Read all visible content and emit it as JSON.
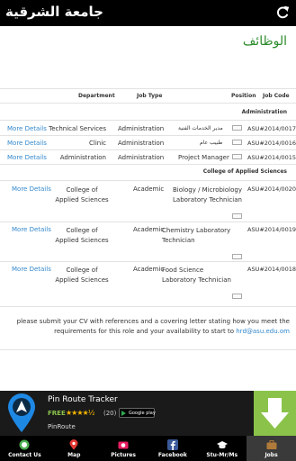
{
  "app": {
    "title": "جامعة الشرقية",
    "refresh_icon": "refresh-icon"
  },
  "page": {
    "heading": "الوظائف"
  },
  "table": {
    "headers": {
      "department": "Department",
      "job_type": "Job Type",
      "position": "Position",
      "job_code": "Job Code"
    },
    "sections": {
      "administration": "Administration",
      "applied_sciences": "College of Applied Sciences"
    },
    "rows": [
      {
        "more": "More Details",
        "department": "Technical Services",
        "job_type": "Administration",
        "position": "مدير الخدمات الفنية",
        "code": "ASU#2014/0017"
      },
      {
        "more": "More Details",
        "department": "Clinic",
        "job_type": "Administration",
        "position": "طبيب عام",
        "code": "ASU#2014/0016"
      },
      {
        "more": "More Details",
        "department": "Administration",
        "job_type": "Administration",
        "position": "Project Manager",
        "code": "ASU#2014/0015"
      },
      {
        "more": "More Details",
        "department": "College of Applied Sciences",
        "job_type": "Academic",
        "position": "Biology / Microbiology Laboratory Technician",
        "code": "ASU#2014/0020"
      },
      {
        "more": "More Details",
        "department": "College of Applied Sciences",
        "job_type": "Academic",
        "position": "Chemistry Laboratory Technician",
        "code": "ASU#2014/0019"
      },
      {
        "more": "More Details",
        "department": "College of Applied Sciences",
        "job_type": "Academic",
        "position": "Food Science Laboratory Technician",
        "code": "ASU#2014/0018"
      }
    ]
  },
  "footnote": {
    "text": "please submit your CV with references and a covering letter stating how you meet the requirements for this role and your availability to start to",
    "email": "hrd@asu.edu.om"
  },
  "ad": {
    "title": "Pin Route Tracker",
    "free": "FREE",
    "stars": "★★★★½",
    "count": "(20)",
    "store": "Google play",
    "brand": "PinRoute",
    "accent": "#8bc34a"
  },
  "nav": [
    {
      "label": "Contact Us",
      "icon": "chat-icon"
    },
    {
      "label": "Map",
      "icon": "map-pin-icon"
    },
    {
      "label": "Pictures",
      "icon": "camera-icon"
    },
    {
      "label": "Facebook",
      "icon": "facebook-icon"
    },
    {
      "label": "Stu-Mr/Ms",
      "icon": "graduation-cap-icon"
    },
    {
      "label": "Jobs",
      "icon": "briefcase-icon"
    }
  ]
}
